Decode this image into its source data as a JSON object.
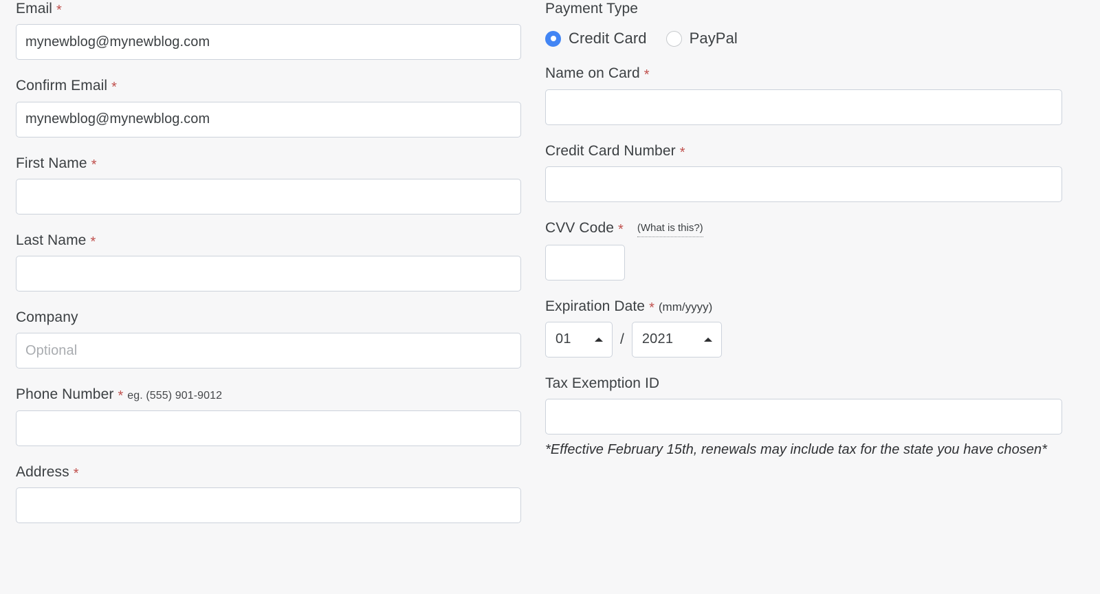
{
  "form": {
    "left_column": {
      "fields": [
        {
          "label": "Email",
          "required": true,
          "value": "mynewblog@mynewblog.com",
          "placeholder": ""
        },
        {
          "label": "Confirm Email",
          "required": true,
          "value": "mynewblog@mynewblog.com",
          "placeholder": ""
        },
        {
          "label": "First Name",
          "required": true,
          "value": "",
          "placeholder": ""
        },
        {
          "label": "Last Name",
          "required": true,
          "value": "",
          "placeholder": ""
        },
        {
          "label": "Company",
          "required": false,
          "value": "",
          "placeholder": "Optional"
        },
        {
          "label": "Phone Number",
          "required": true,
          "value": "",
          "placeholder": "",
          "hint": "eg. (555) 901-9012"
        },
        {
          "label": "Address",
          "required": true,
          "value": "",
          "placeholder": ""
        }
      ]
    },
    "right_column": {
      "payment_type": {
        "label": "Payment Type",
        "options": [
          {
            "label": "Credit Card",
            "selected": true
          },
          {
            "label": "PayPal",
            "selected": false
          }
        ]
      },
      "name_on_card": {
        "label": "Name on Card",
        "required": true,
        "value": "",
        "placeholder": ""
      },
      "credit_card_number": {
        "label": "Credit Card Number",
        "required": true,
        "value": "",
        "placeholder": ""
      },
      "cvv": {
        "label": "CVV Code",
        "required": true,
        "value": "",
        "placeholder": "",
        "tooltip_link": "(What is this?)"
      },
      "expiration": {
        "label": "Expiration Date",
        "required": true,
        "format_hint": "(mm/yyyy)",
        "month": "01",
        "year": "2021",
        "separator": "/"
      },
      "tax_exemption": {
        "label": "Tax Exemption ID",
        "required": false,
        "value": "",
        "placeholder": "",
        "note": "*Effective February 15th, renewals may include tax for the state you have chosen*"
      }
    },
    "required_marker": "*"
  },
  "colors": {
    "page_background": "#f7f7f8",
    "input_background": "#ffffff",
    "input_border": "#ccd2db",
    "label_text": "#3c4043",
    "required_asterisk": "#c0504d",
    "radio_selected": "#4285f4",
    "radio_border": "#c7cacd",
    "placeholder_text": "#a9acb0"
  }
}
